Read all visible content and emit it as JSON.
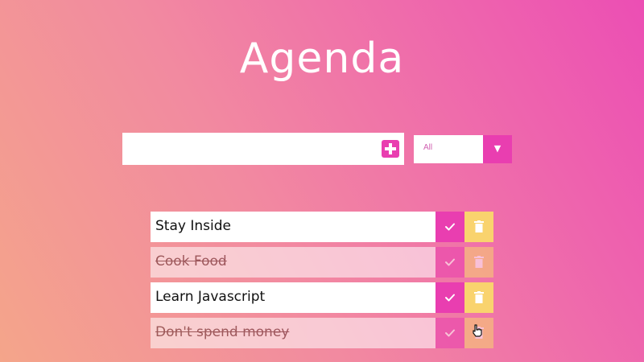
{
  "header": {
    "title": "Agenda"
  },
  "new_todo": {
    "value": "",
    "placeholder": "",
    "add_icon": "plus-square-icon"
  },
  "filter": {
    "selected": "All",
    "arrow": "▼"
  },
  "todos": [
    {
      "text": "Stay Inside",
      "completed": false
    },
    {
      "text": "Cook Food",
      "completed": true
    },
    {
      "text": "Learn Javascript",
      "completed": false
    },
    {
      "text": "Don't spend money",
      "completed": true
    }
  ],
  "colors": {
    "accent": "#e93eb0",
    "trash": "#f9d36e",
    "gradient_start": "#f4a58a",
    "gradient_end": "#ec4eb4"
  },
  "icons": {
    "complete": "check-icon",
    "delete": "trash-icon",
    "cursor": "hand-pointer-icon"
  }
}
